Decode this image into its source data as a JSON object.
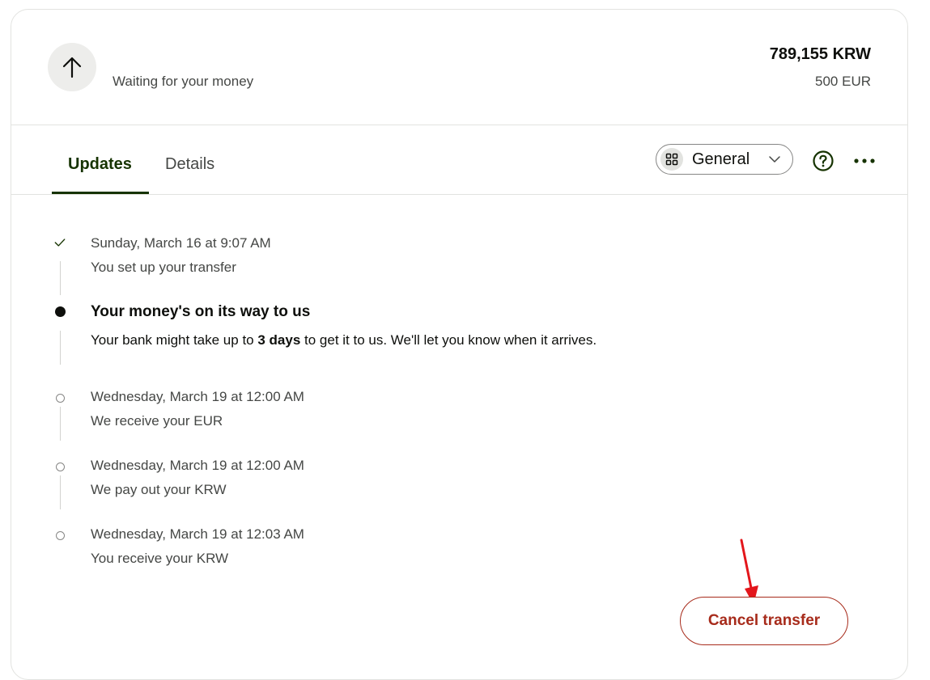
{
  "header": {
    "status_text": "Waiting for your money",
    "amount_target": "789,155 KRW",
    "amount_source": "500 EUR",
    "icon": "arrow-up-icon"
  },
  "tabs": [
    {
      "label": "Updates",
      "active": true
    },
    {
      "label": "Details",
      "active": false
    }
  ],
  "toolbar": {
    "dropdown_label": "General",
    "dropdown_icon": "grid-icon",
    "help_icon": "help-icon",
    "more_icon": "more-icon"
  },
  "timeline": [
    {
      "state": "done",
      "title": "Sunday, March 16 at 9:07 AM",
      "desc": "You set up your transfer"
    },
    {
      "state": "current",
      "title": "Your money's on its way to us",
      "desc_before": "Your bank might take up to ",
      "desc_bold": "3 days",
      "desc_after": " to get it to us. We'll let you know when it arrives."
    },
    {
      "state": "pending",
      "title": "Wednesday, March 19 at 12:00 AM",
      "desc": "We receive your EUR"
    },
    {
      "state": "pending",
      "title": "Wednesday, March 19 at 12:00 AM",
      "desc": "We pay out your KRW"
    },
    {
      "state": "pending",
      "title": "Wednesday, March 19 at 12:03 AM",
      "desc": "You receive your KRW"
    }
  ],
  "actions": {
    "cancel_label": "Cancel transfer"
  },
  "colors": {
    "brand_dark": "#163300",
    "danger": "#a72b1b",
    "annotation": "#e3161b"
  }
}
